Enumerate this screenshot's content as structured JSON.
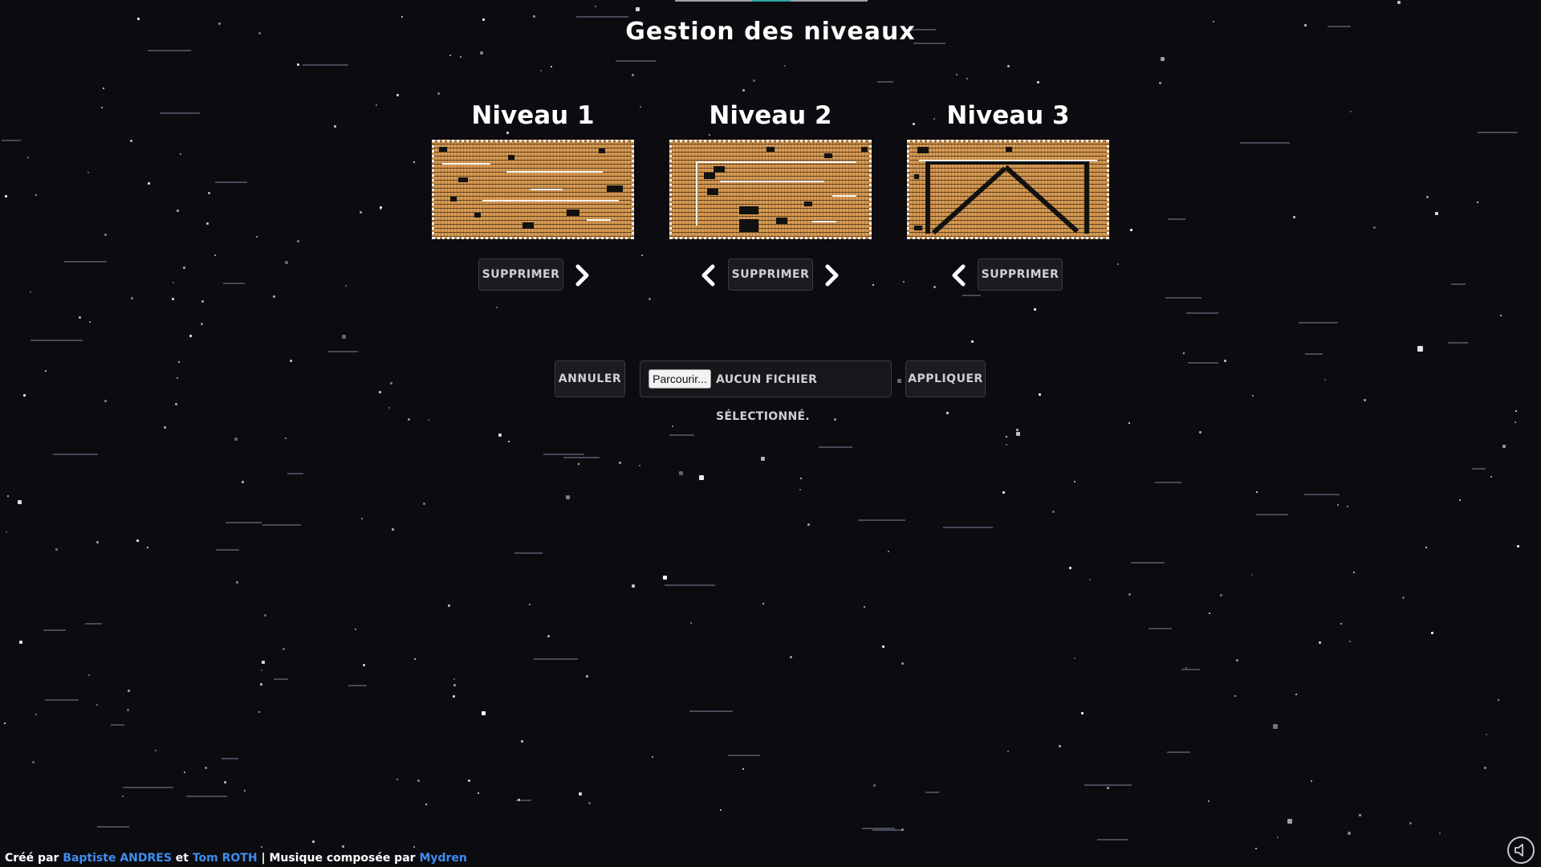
{
  "page": {
    "title": "Gestion des niveaux"
  },
  "levels": [
    {
      "title": "Niveau 1",
      "delete_label": "SUPPRIMER",
      "has_prev": false,
      "has_next": true
    },
    {
      "title": "Niveau 2",
      "delete_label": "SUPPRIMER",
      "has_prev": true,
      "has_next": true
    },
    {
      "title": "Niveau 3",
      "delete_label": "SUPPRIMER",
      "has_prev": true,
      "has_next": false
    }
  ],
  "actions": {
    "cancel_label": "ANNULER",
    "browse_label": "Parcourir...",
    "file_status": "AUCUN FICHIER SÉLECTIONNÉ.",
    "apply_label": "APPLIQUER"
  },
  "footer": {
    "created_by": "Créé par",
    "author1": "Baptiste ANDRES",
    "and": "et",
    "author2": "Tom ROTH",
    "separator": "|",
    "music_by": "Musique composée par",
    "composer": "Mydren"
  },
  "colors": {
    "background": "#0b0b10",
    "level_tile": "#d89a52",
    "link": "#3d8ef0",
    "button_bg": "#1b1c21"
  },
  "icons": {
    "prev": "chevron-left-icon",
    "next": "chevron-right-icon",
    "sound": "speaker-mute-icon"
  }
}
